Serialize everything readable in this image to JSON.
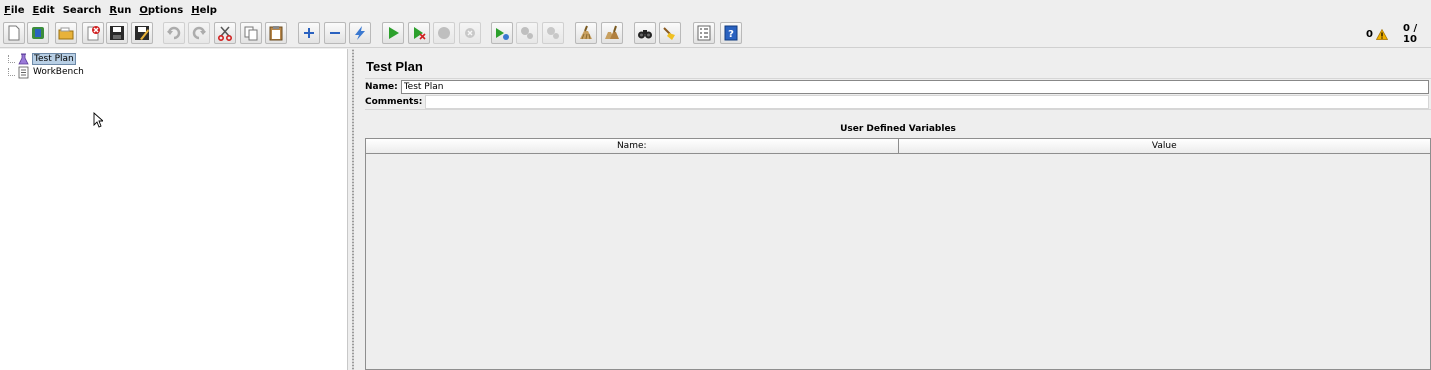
{
  "menu": {
    "items": [
      {
        "mnemonic": "F",
        "rest": "ile"
      },
      {
        "mnemonic": "E",
        "rest": "dit"
      },
      {
        "mnemonic": "",
        "rest": "Search"
      },
      {
        "mnemonic": "R",
        "rest": "un"
      },
      {
        "mnemonic": "O",
        "rest": "ptions"
      },
      {
        "mnemonic": "H",
        "rest": "elp"
      }
    ]
  },
  "toolbar": {
    "icons": [
      "new-icon",
      "templates-icon",
      "open-icon",
      "close-icon",
      "save-icon",
      "save-as-icon",
      "undo-icon",
      "redo-icon",
      "cut-icon",
      "copy-icon",
      "paste-icon",
      "expand-icon",
      "collapse-icon",
      "toggle-icon",
      "start-icon",
      "start-no-pauses-icon",
      "stop-icon",
      "shutdown-icon",
      "remote-start-icon",
      "remote-stop-icon",
      "remote-shutdown-icon",
      "clear-icon",
      "clear-all-icon",
      "search-icon",
      "reset-search-icon",
      "function-helper-icon",
      "help-icon"
    ]
  },
  "status": {
    "warnings": "0",
    "threads": "0 / 10",
    "accent": "#f0b000"
  },
  "tree": {
    "items": [
      {
        "label": "Test Plan",
        "icon": "test-plan-icon",
        "selected": true
      },
      {
        "label": "WorkBench",
        "icon": "workbench-icon",
        "selected": false
      }
    ]
  },
  "panel": {
    "title": "Test Plan",
    "name_label": "Name:",
    "name_value": "Test Plan",
    "comments_label": "Comments:",
    "udv_title": "User Defined Variables",
    "columns": [
      "Name:",
      "Value"
    ]
  }
}
